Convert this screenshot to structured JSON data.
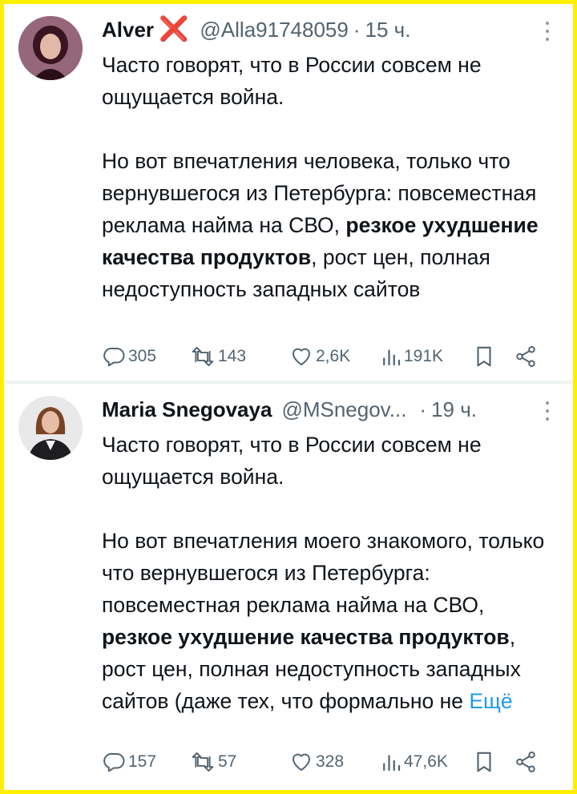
{
  "tweets": [
    {
      "author": {
        "name": "Alver",
        "badge": "❌",
        "handle": "@Alla91748059",
        "time": "15 ч."
      },
      "text": {
        "p1": "Часто говорят, что в России совсем не ощущается война.",
        "p2_before": "Но вот впечатления человека, только что вернувшегося из Петербурга: повсеместная реклама найма на СВО, ",
        "p2_bold": "резкое ухудшение качества продуктов",
        "p2_after": ", рост цен, полная недоступность западных сайтов"
      },
      "stats": {
        "replies": "305",
        "retweets": "143",
        "likes": "2,6K",
        "views": "191K"
      }
    },
    {
      "author": {
        "name": "Maria Snegovaya",
        "handle": "@MSnegov...",
        "time": "19 ч."
      },
      "text": {
        "p1": "Часто говорят, что в России совсем не ощущается война.",
        "p2_before": "Но вот впечатления моего знакомого, только что вернувшегося из Петербурга: повсеместная реклама найма на СВО, ",
        "p2_bold": "резкое ухудшение качества продуктов",
        "p2_after": ", рост цен, полная недоступность западных сайтов (даже тех, что формально не ",
        "more": "Ещё"
      },
      "stats": {
        "replies": "157",
        "retweets": "57",
        "likes": "328",
        "views": "47,6K"
      }
    }
  ],
  "ui": {
    "dot": "·",
    "icons": [
      "reply-icon",
      "retweet-icon",
      "like-icon",
      "views-icon",
      "bookmark-icon",
      "share-icon",
      "more-icon"
    ]
  },
  "colors": {
    "frame": "#ffef00",
    "text": "#0f1419",
    "secondary": "#536471",
    "link": "#1d9bf0",
    "badge": "#e8201f"
  }
}
